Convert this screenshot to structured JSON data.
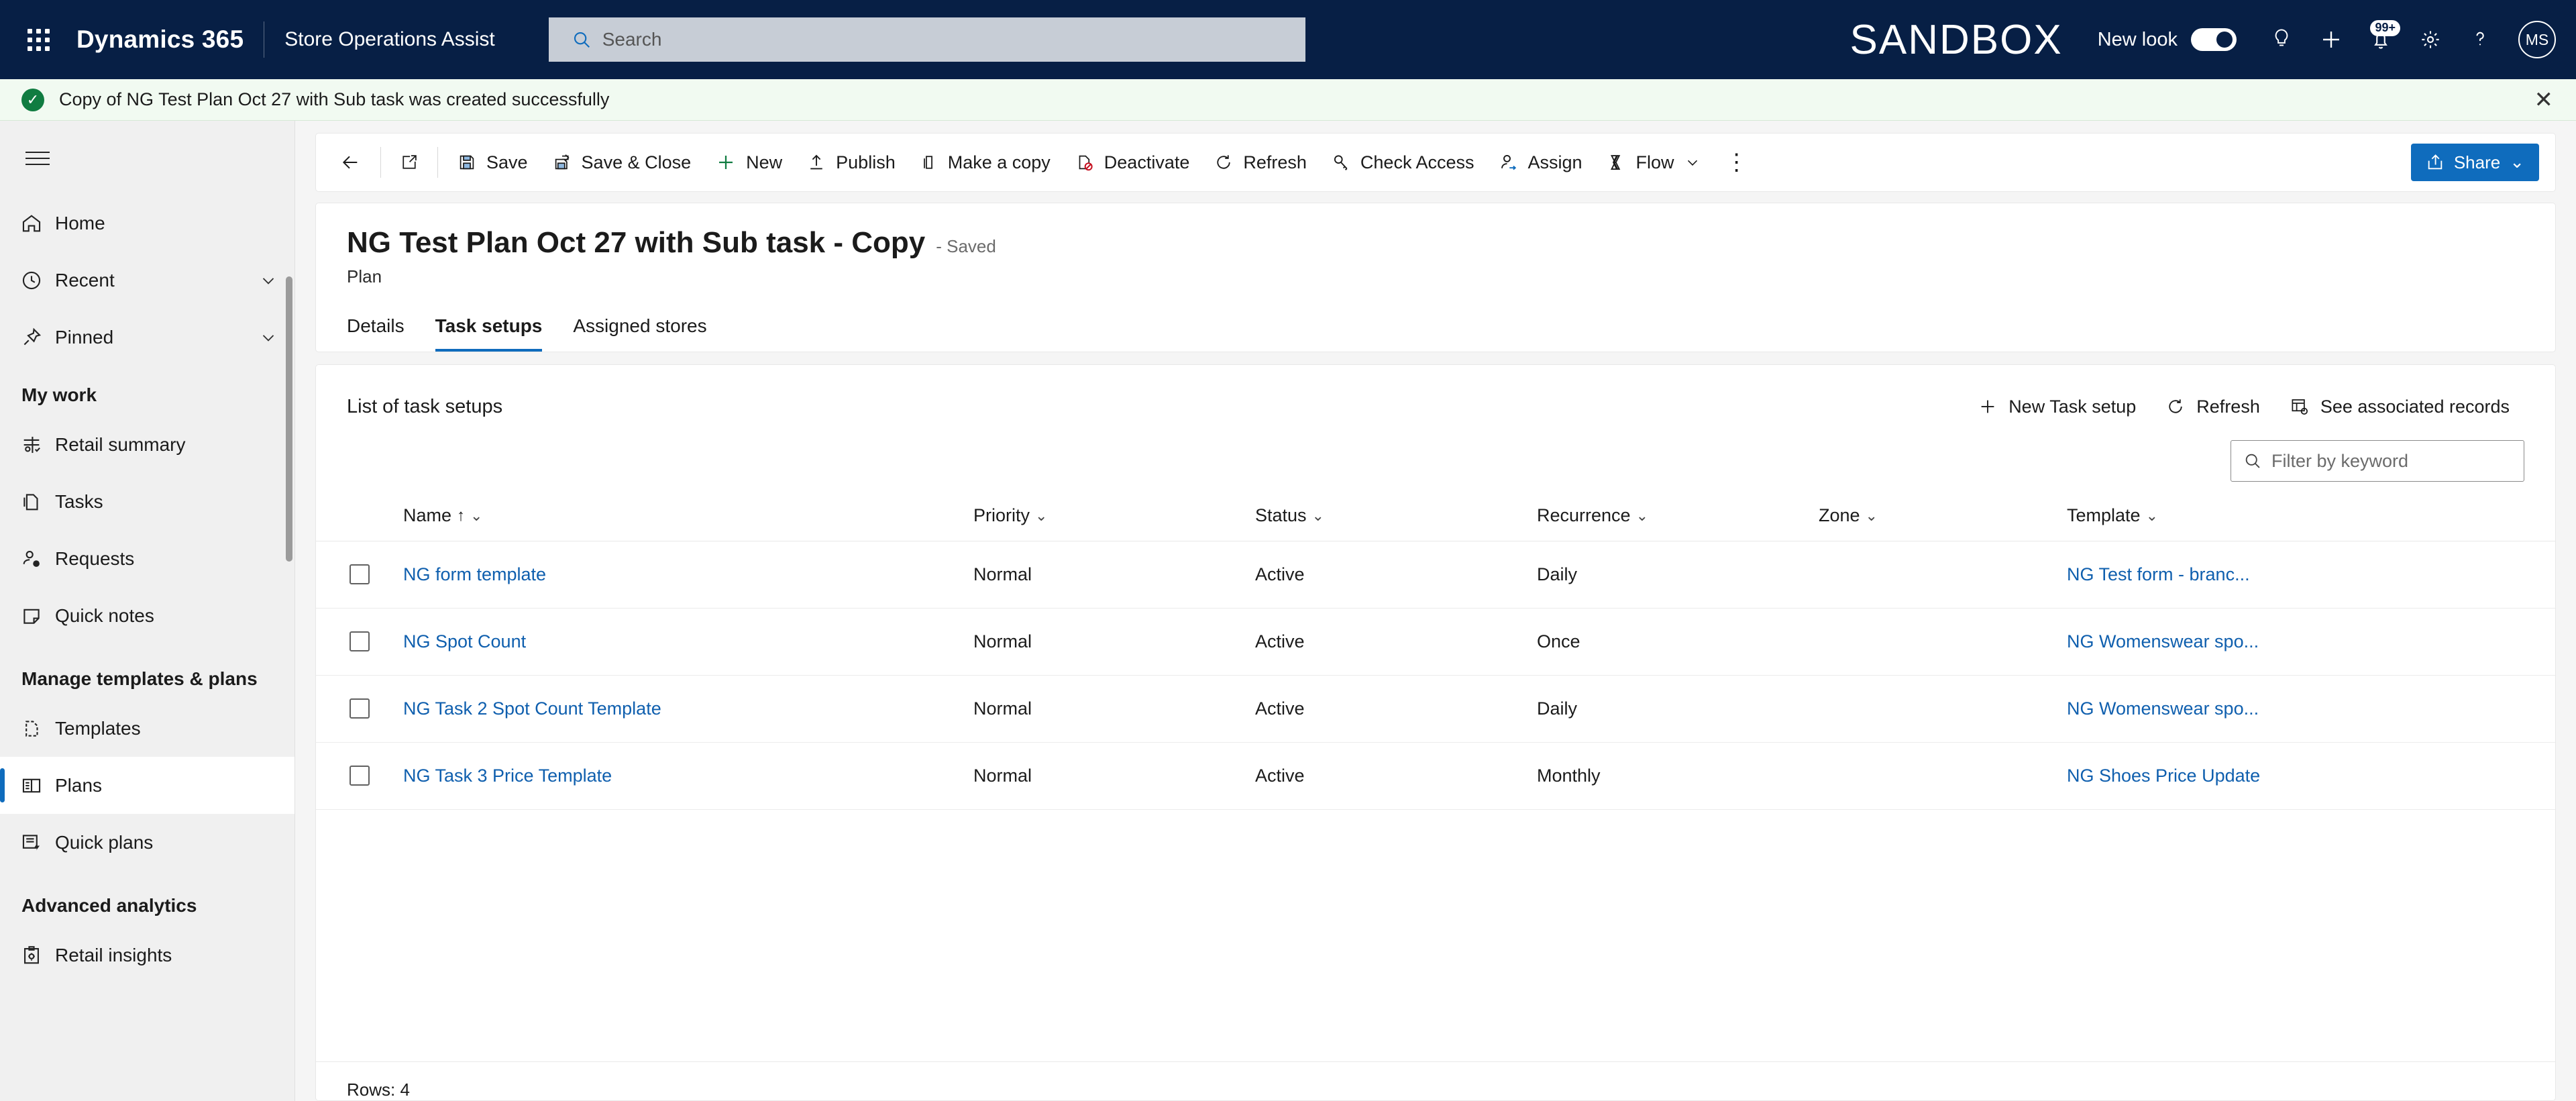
{
  "topnav": {
    "waffle_label": "app-launcher",
    "brand": "Dynamics 365",
    "app_name": "Store Operations Assist",
    "search": {
      "value": "",
      "placeholder": "Search"
    },
    "environment_label": "SANDBOX",
    "new_look": {
      "label": "New look",
      "state": "on"
    },
    "icons": [
      {
        "name": "lightbulb-icon",
        "title": "Tips"
      },
      {
        "name": "plus-icon",
        "title": "Quick create"
      },
      {
        "name": "bell-icon",
        "title": "Notifications",
        "badge": "99+"
      },
      {
        "name": "gear-icon",
        "title": "Settings"
      },
      {
        "name": "question-icon",
        "title": "Help"
      }
    ],
    "avatar_initials": "MS"
  },
  "notification": {
    "icon": "success-check-icon",
    "message": "Copy of NG Test Plan Oct 27 with Sub task was created successfully",
    "close_label": "✕",
    "accent_color": "#107c41",
    "background": "#f1faf1"
  },
  "sidebar": {
    "hamburger_label": "collapse-navigation",
    "items": [
      {
        "label": "Home",
        "icon": "home-icon",
        "chevron": false,
        "active": false
      },
      {
        "label": "Recent",
        "icon": "clock-icon",
        "chevron": true,
        "active": false
      },
      {
        "label": "Pinned",
        "icon": "pin-icon",
        "chevron": true,
        "active": false
      }
    ],
    "groups": [
      {
        "title": "My work",
        "items": [
          {
            "label": "Retail summary",
            "icon": "chart-icon",
            "active": false
          },
          {
            "label": "Tasks",
            "icon": "documents-icon",
            "active": false
          },
          {
            "label": "Requests",
            "icon": "person-question-icon",
            "active": false
          },
          {
            "label": "Quick notes",
            "icon": "note-icon",
            "active": false
          }
        ]
      },
      {
        "title": "Manage templates & plans",
        "items": [
          {
            "label": "Templates",
            "icon": "template-icon",
            "active": false
          },
          {
            "label": "Plans",
            "icon": "plan-icon",
            "active": true
          },
          {
            "label": "Quick plans",
            "icon": "quick-plan-icon",
            "active": false
          }
        ]
      },
      {
        "title": "Advanced analytics",
        "items": [
          {
            "label": "Retail insights",
            "icon": "insights-icon",
            "active": false
          }
        ]
      }
    ]
  },
  "commandbar": {
    "back_label": "←",
    "popout_label": "open-in-new-window",
    "commands": [
      {
        "label": "Save",
        "icon": "save-icon"
      },
      {
        "label": "Save & Close",
        "icon": "save-close-icon"
      },
      {
        "label": "New",
        "icon": "plus-icon"
      },
      {
        "label": "Publish",
        "icon": "publish-icon"
      },
      {
        "label": "Make a copy",
        "icon": "copy-icon"
      },
      {
        "label": "Deactivate",
        "icon": "deactivate-icon"
      },
      {
        "label": "Refresh",
        "icon": "refresh-icon"
      },
      {
        "label": "Check Access",
        "icon": "key-icon"
      },
      {
        "label": "Assign",
        "icon": "assign-person-icon"
      },
      {
        "label": "Flow",
        "icon": "flow-icon",
        "chevron": true
      }
    ],
    "overflow_label": "⋮",
    "share": {
      "label": "Share",
      "icon": "share-icon",
      "chevron": "⌄",
      "color": "#0f6cbd"
    }
  },
  "record": {
    "title": "NG Test Plan Oct 27 with Sub task - Copy",
    "save_state": "- Saved",
    "entity": "Plan",
    "tabs": [
      {
        "label": "Details",
        "selected": false
      },
      {
        "label": "Task setups",
        "selected": true
      },
      {
        "label": "Assigned stores",
        "selected": false
      }
    ]
  },
  "subgrid": {
    "title": "List of task setups",
    "actions": [
      {
        "label": "New Task setup",
        "icon": "plus-icon"
      },
      {
        "label": "Refresh",
        "icon": "refresh-icon"
      },
      {
        "label": "See associated records",
        "icon": "grid-link-icon"
      }
    ],
    "filter": {
      "value": "",
      "placeholder": "Filter by keyword",
      "icon": "search-icon"
    },
    "columns": [
      {
        "label": "Name",
        "sort": "↑",
        "chevron": "⌄"
      },
      {
        "label": "Priority",
        "sort": "",
        "chevron": "⌄"
      },
      {
        "label": "Status",
        "sort": "",
        "chevron": "⌄"
      },
      {
        "label": "Recurrence",
        "sort": "",
        "chevron": "⌄"
      },
      {
        "label": "Zone",
        "sort": "",
        "chevron": "⌄"
      },
      {
        "label": "Template",
        "sort": "",
        "chevron": "⌄"
      }
    ],
    "rows": [
      {
        "selected": false,
        "name": "NG form template",
        "priority": "Normal",
        "status": "Active",
        "recurrence": "Daily",
        "zone": "",
        "template": "NG Test form - branc..."
      },
      {
        "selected": false,
        "name": "NG Spot Count",
        "priority": "Normal",
        "status": "Active",
        "recurrence": "Once",
        "zone": "",
        "template": "NG Womenswear spo..."
      },
      {
        "selected": false,
        "name": "NG Task 2 Spot Count Template",
        "priority": "Normal",
        "status": "Active",
        "recurrence": "Daily",
        "zone": "",
        "template": "NG Womenswear spo..."
      },
      {
        "selected": false,
        "name": "NG Task 3 Price Template",
        "priority": "Normal",
        "status": "Active",
        "recurrence": "Monthly",
        "zone": "",
        "template": "NG Shoes Price Update"
      }
    ],
    "rows_footer": "Rows: 4"
  }
}
